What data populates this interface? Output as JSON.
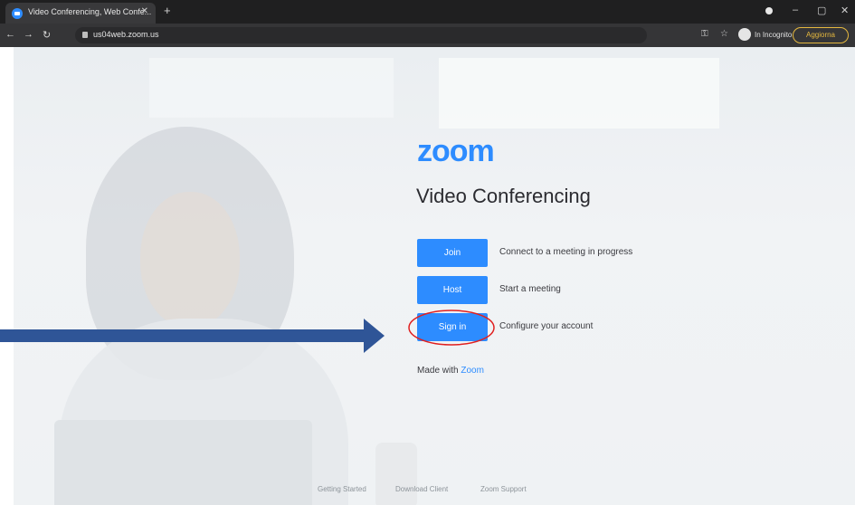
{
  "browser": {
    "tab_title": "Video Conferencing, Web Confe...",
    "tab_close": "✕",
    "new_tab": "+",
    "url": "us04web.zoom.us",
    "incognito_label": "In Incognito",
    "menu_label": "Aggiorna",
    "window_min": "–",
    "window_max": "▢",
    "window_close": "✕"
  },
  "page": {
    "logo": "zoom",
    "heading": "Video Conferencing",
    "actions": [
      {
        "button": "Join",
        "description": "Connect to a meeting in progress"
      },
      {
        "button": "Host",
        "description": "Start a meeting"
      },
      {
        "button": "Sign in",
        "description": "Configure your account"
      }
    ],
    "made_with_prefix": "Made with ",
    "made_with_link": "Zoom",
    "footer": [
      "Getting Started",
      "Download Client",
      "Zoom Support"
    ]
  },
  "colors": {
    "brand": "#2d8cff",
    "annotation_arrow": "#2f5597",
    "annotation_circle": "#e02020",
    "tab_strip": "#1f1f20",
    "toolbar": "#353537"
  },
  "icons": [
    "zoom-favicon-icon",
    "back-arrow-icon",
    "forward-arrow-icon",
    "reload-icon",
    "lock-icon",
    "key-icon",
    "star-icon",
    "incognito-icon"
  ]
}
